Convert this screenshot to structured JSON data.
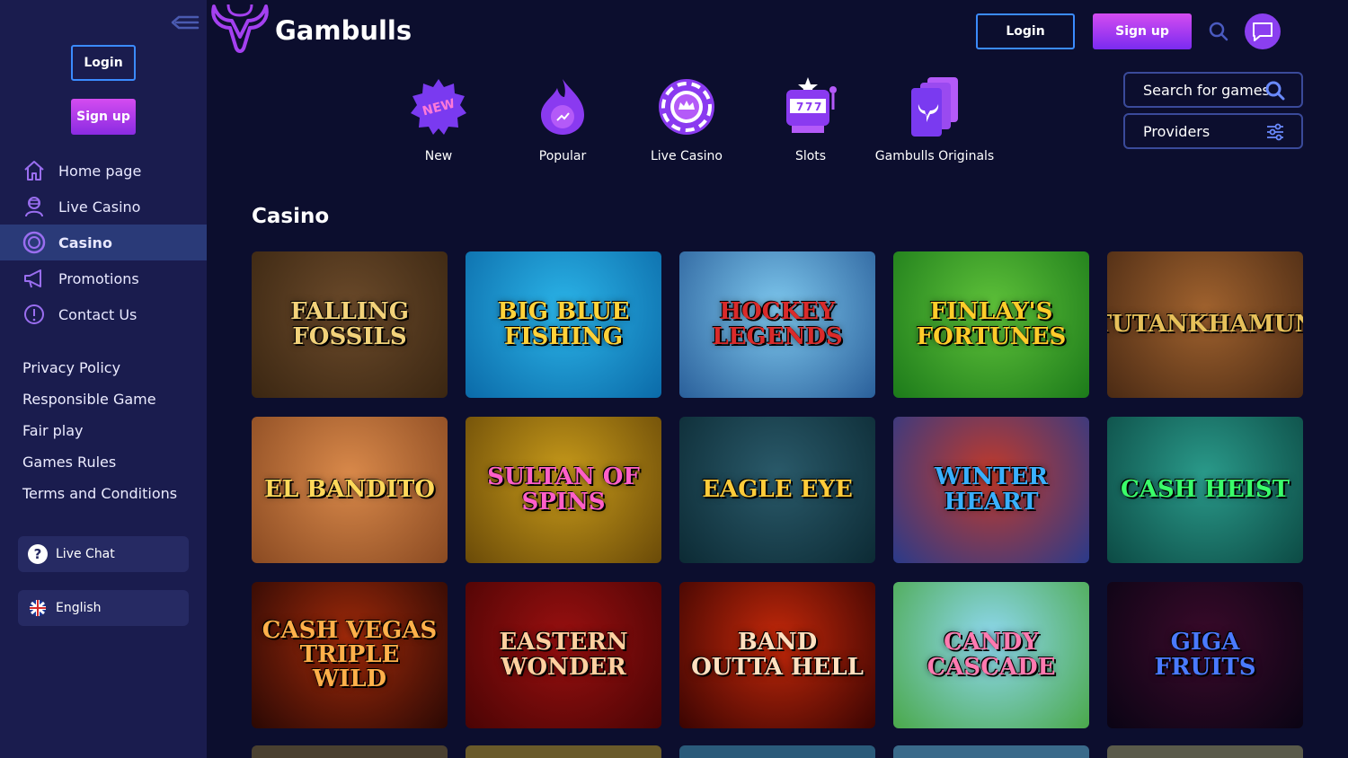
{
  "brand": {
    "name": "Gambulls",
    "accent": "#8b3ff0",
    "sidebar_bg": "#1a1c4e",
    "page_bg": "#0c0e2e"
  },
  "sidebar": {
    "login_label": "Login",
    "signup_label": "Sign up",
    "nav": [
      {
        "label": "Home page",
        "icon": "home-icon",
        "active": false
      },
      {
        "label": "Live Casino",
        "icon": "dealer-icon",
        "active": false
      },
      {
        "label": "Casino",
        "icon": "casino-chip-icon",
        "active": true
      },
      {
        "label": "Promotions",
        "icon": "megaphone-icon",
        "active": false
      },
      {
        "label": "Contact Us",
        "icon": "info-icon",
        "active": false
      }
    ],
    "links": [
      "Privacy Policy",
      "Responsible Game",
      "Fair play",
      "Games Rules",
      "Terms and Conditions"
    ],
    "live_chat_label": "Live Chat",
    "language_label": "English"
  },
  "header": {
    "login_label": "Login",
    "signup_label": "Sign up"
  },
  "categories": [
    {
      "label": "New",
      "icon": "new-badge-icon"
    },
    {
      "label": "Popular",
      "icon": "flame-icon"
    },
    {
      "label": "Live Casino",
      "icon": "roulette-icon"
    },
    {
      "label": "Slots",
      "icon": "slot-machine-icon"
    },
    {
      "label": "Gambulls Originals",
      "icon": "originals-cards-icon"
    }
  ],
  "search": {
    "placeholder": "Search for games"
  },
  "providers": {
    "label": "Providers"
  },
  "section_title": "Casino",
  "games": [
    {
      "title": "Falling Fossils",
      "bg1": "#6b4a2a",
      "bg2": "#3a2612",
      "fg": "#f2d27a"
    },
    {
      "title": "Big Blue Fishing",
      "bg1": "#2bb4e8",
      "bg2": "#0b6aa8",
      "fg": "#ffd23a"
    },
    {
      "title": "Hockey Legends",
      "bg1": "#7ec8ee",
      "bg2": "#2a5f9a",
      "fg": "#d92b2b"
    },
    {
      "title": "Finlay's Fortunes",
      "bg1": "#5fc23a",
      "bg2": "#1c7a1a",
      "fg": "#ffcc2a"
    },
    {
      "title": "Tutankhamun",
      "bg1": "#a0622e",
      "bg2": "#4a2a14",
      "fg": "#e6c05a"
    },
    {
      "title": "El Bandito",
      "bg1": "#d9894a",
      "bg2": "#8a4a22",
      "fg": "#ffd85a"
    },
    {
      "title": "Sultan of Spins",
      "bg1": "#c79a1a",
      "bg2": "#6a4a08",
      "fg": "#ff5fc8"
    },
    {
      "title": "Eagle Eye",
      "bg1": "#2a5a6a",
      "bg2": "#0c2a34",
      "fg": "#ffcc3a"
    },
    {
      "title": "Winter Heart",
      "bg1": "#c23a2a",
      "bg2": "#2a3a8a",
      "fg": "#3ab0ff"
    },
    {
      "title": "Cash Heist",
      "bg1": "#2a9a8a",
      "bg2": "#0c4a44",
      "fg": "#3aff6a"
    },
    {
      "title": "Cash Vegas Triple Wild",
      "bg1": "#a02a0a",
      "bg2": "#2a0804",
      "fg": "#ffb04a"
    },
    {
      "title": "Eastern Wonder",
      "bg1": "#9a1010",
      "bg2": "#4a0404",
      "fg": "#ffd0a0"
    },
    {
      "title": "Band outta Hell",
      "bg1": "#c2280a",
      "bg2": "#3a0402",
      "fg": "#ffe0c0"
    },
    {
      "title": "Candy Cascade",
      "bg1": "#8fd8f0",
      "bg2": "#4aa84a",
      "fg": "#ff7ab0"
    },
    {
      "title": "Giga Fruits",
      "bg1": "#3a0a2a",
      "bg2": "#0a0414",
      "fg": "#4a7aff"
    }
  ]
}
